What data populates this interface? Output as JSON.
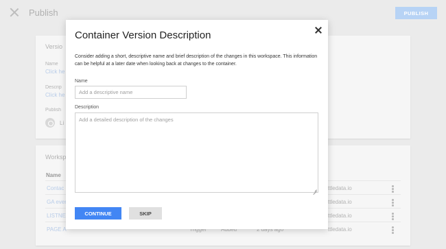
{
  "header": {
    "title": "Publish",
    "publish_label": "PUBLISH"
  },
  "background": {
    "version_card": {
      "heading": "Versio",
      "name_label": "Name",
      "name_link": "Click he",
      "description_label": "Descrip",
      "description_link": "Click he",
      "publish_label": "Publish",
      "env_text": "Li"
    },
    "workspace_card": {
      "heading": "Worksp",
      "column_name": "Name",
      "rows": [
        {
          "name": "Contac",
          "email": "ttledata.io"
        },
        {
          "name": "GA even",
          "email": "ttledata.io"
        },
        {
          "name": "LISTNE",
          "email": "ttledata.io"
        },
        {
          "name": "PAGE A",
          "type": "Trigger",
          "action": "Added",
          "date": "2 days ago",
          "email": "ttledata.io"
        }
      ]
    }
  },
  "modal": {
    "title": "Container Version Description",
    "description": "Consider adding a short, descriptive name and brief description of the changes in this workspace. This information can be helpful at a later date when looking back at changes to the container.",
    "name_label": "Name",
    "name_placeholder": "Add a descriptive name",
    "description_label": "Description",
    "description_placeholder": "Add a detailed description of the changes",
    "continue_label": "CONTINUE",
    "skip_label": "SKIP"
  },
  "colors": {
    "primary": "#4286f4",
    "publish_disabled": "#b7d3f5"
  }
}
